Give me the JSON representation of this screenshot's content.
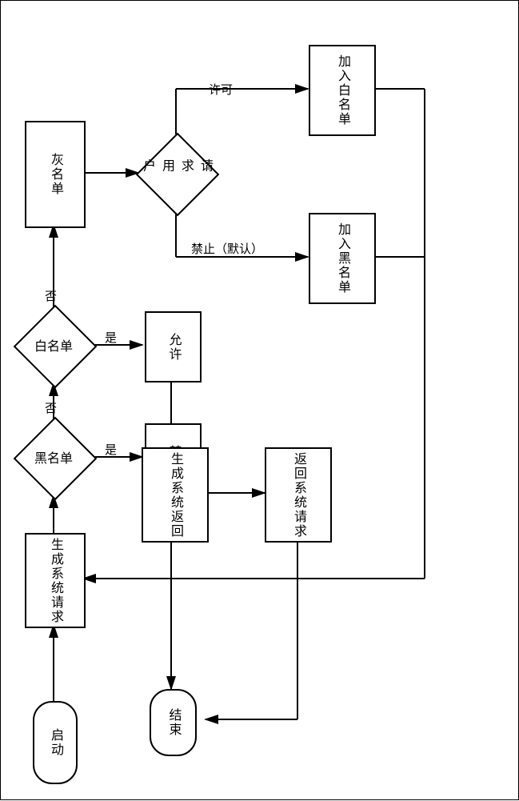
{
  "flow": {
    "start": "启动",
    "gen_request": "生成系统请求",
    "blacklist": "黑名单",
    "whitelist": "白名单",
    "graylist": "灰名单",
    "ask_user": "请求用户",
    "allow": "允许",
    "forbid": "禁止",
    "add_black": "加入黑名单",
    "add_white": "加入白名单",
    "gen_return": "生成系统返回",
    "return_req": "返回系统请求",
    "end": "结束"
  },
  "labels": {
    "yes1": "是",
    "no1": "否",
    "yes2": "是",
    "no2": "否",
    "permit": "许可",
    "deny_default": "禁止（默认）"
  }
}
